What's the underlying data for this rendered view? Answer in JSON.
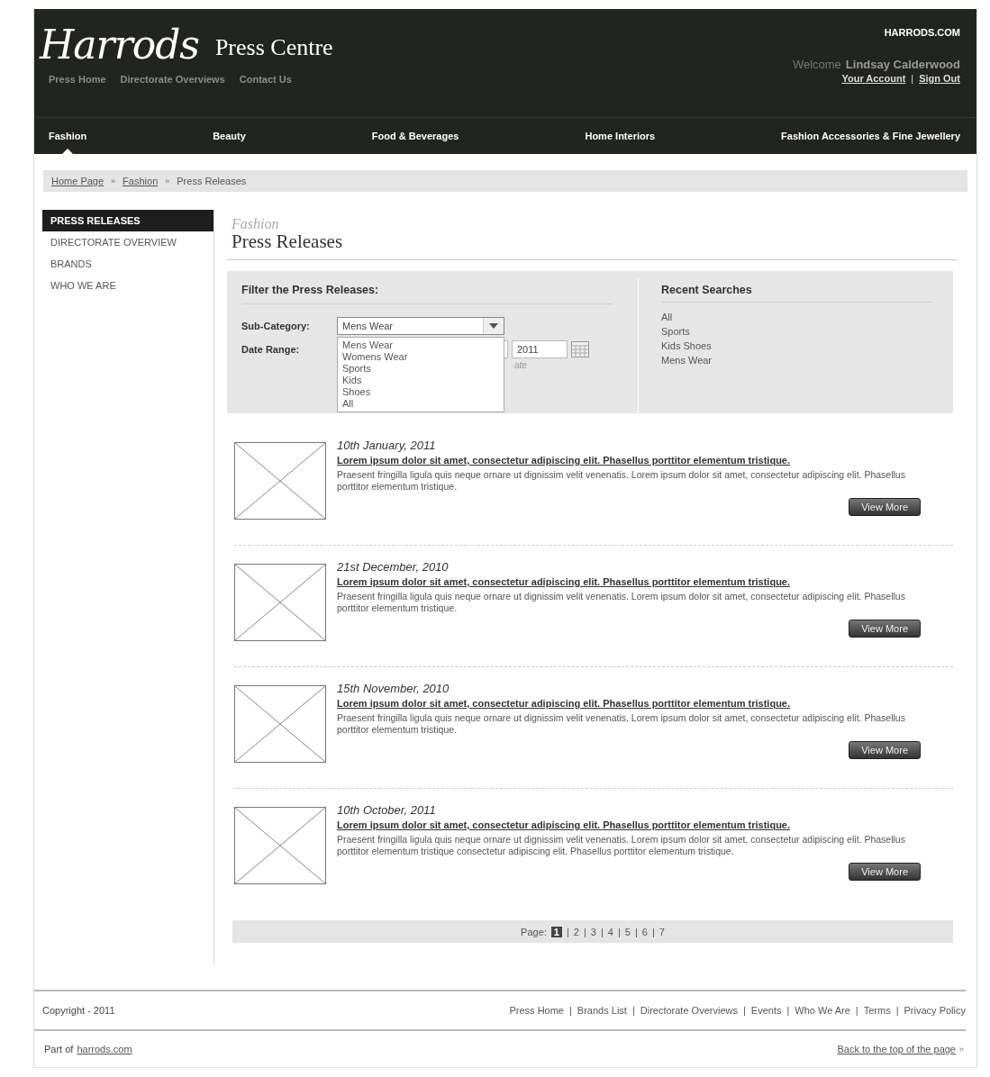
{
  "header": {
    "logo": "Harrods",
    "site_title": "Press Centre",
    "top_link": "HARRODS.COM",
    "welcome": "Welcome",
    "user_name": "Lindsay Calderwood",
    "account_links": [
      {
        "label": "Your Account"
      },
      {
        "label": "Sign Out",
        "separator": "|"
      }
    ],
    "sub_nav": [
      "Press Home",
      "Directorate Overviews",
      "Contact Us"
    ]
  },
  "main_nav": [
    {
      "label": "Fashion",
      "selected": true
    },
    {
      "label": "Beauty",
      "selected": false
    },
    {
      "label": "Food & Beverages",
      "selected": false
    },
    {
      "label": "Home Interiors",
      "selected": false
    },
    {
      "label": "Fashion Accessories & Fine Jewellery",
      "selected": false
    }
  ],
  "breadcrumb": [
    {
      "label": "Home Page",
      "link": true
    },
    {
      "label": "Fashion",
      "link": true,
      "separator": "»"
    },
    {
      "label": "Press Releases",
      "link": false,
      "separator": "»"
    }
  ],
  "sidebar": {
    "items": [
      {
        "label": "PRESS RELEASES",
        "selected": true
      },
      {
        "label": "DIRECTORATE OVERVIEW",
        "selected": false
      },
      {
        "label": "BRANDS",
        "selected": false
      },
      {
        "label": "WHO WE ARE",
        "selected": false
      }
    ]
  },
  "page_heading": {
    "section": "Fashion",
    "title": "Press Releases"
  },
  "filter": {
    "title": "Filter the Press Releases:",
    "sub_category": {
      "label": "Sub-Category:",
      "value": "Mens Wear",
      "expanded": true,
      "options": [
        "Mens Wear",
        "Womens Wear",
        "Sports",
        "Kids",
        "Shoes",
        "All"
      ]
    },
    "date_range": {
      "label": "Date Range:",
      "year": "2011",
      "hint": "ate"
    }
  },
  "recent_searches": {
    "title": "Recent Searches",
    "items": [
      "All",
      "Sports",
      "Kids Shoes",
      "Mens Wear"
    ]
  },
  "releases": [
    {
      "date": "10th January, 2011",
      "headline": "Lorem ipsum dolor sit amet, consectetur adipiscing elit. Phasellus porttitor elementum tristique.",
      "summary": "Praesent fringilla ligula quis neque ornare ut dignissim velit venenatis. Lorem ipsum dolor sit amet, consectetur adipiscing elit. Phasellus porttitor elementum tristique.",
      "button": "View More"
    },
    {
      "date": "21st December, 2010",
      "headline": "Lorem ipsum dolor sit amet, consectetur adipiscing elit. Phasellus porttitor elementum tristique.",
      "summary": "Praesent fringilla ligula quis neque ornare ut dignissim velit venenatis. Lorem ipsum dolor sit amet, consectetur adipiscing elit. Phasellus porttitor elementum tristique.",
      "button": "View More"
    },
    {
      "date": "15th November, 2010",
      "headline": "Lorem ipsum dolor sit amet, consectetur adipiscing elit. Phasellus porttitor elementum tristique.",
      "summary": "Praesent fringilla ligula quis neque ornare ut dignissim velit venenatis. Lorem ipsum dolor sit amet, consectetur adipiscing elit. Phasellus porttitor elementum tristique.",
      "button": "View More"
    },
    {
      "date": "10th October, 2011",
      "headline": "Lorem ipsum dolor sit amet, consectetur adipiscing elit. Phasellus porttitor elementum tristique.",
      "summary": "Praesent fringilla ligula quis neque ornare ut dignissim velit venenatis. Lorem ipsum dolor sit amet, consectetur adipiscing elit. Phasellus porttitor elementum tristique consectetur adipiscing elit. Phasellus porttitor elementum tristique.",
      "button": "View More"
    }
  ],
  "pagination": {
    "label": "Page:",
    "pages": [
      {
        "label": "1",
        "selected": true
      },
      {
        "label": "2",
        "selected": false,
        "separator": "|"
      },
      {
        "label": "3",
        "selected": false,
        "separator": "|"
      },
      {
        "label": "4",
        "selected": false,
        "separator": "|"
      },
      {
        "label": "5",
        "selected": false,
        "separator": "|"
      },
      {
        "label": "6",
        "selected": false,
        "separator": "|"
      },
      {
        "label": "7",
        "selected": false,
        "separator": "|"
      }
    ]
  },
  "footer": {
    "copyright": "Copyright - 2011",
    "links": [
      {
        "label": "Press Home"
      },
      {
        "label": "Brands List",
        "separator": "|"
      },
      {
        "label": "Directorate Overviews",
        "separator": "|"
      },
      {
        "label": "Events",
        "separator": "|"
      },
      {
        "label": "Who We Are",
        "separator": "|"
      },
      {
        "label": "Terms",
        "separator": "|"
      },
      {
        "label": "Privacy Policy",
        "separator": "|"
      }
    ],
    "part_of": "Part of",
    "part_of_link": "harrods.com",
    "back_to_top": "Back to the top of the page",
    "back_to_top_arrow": "»"
  }
}
